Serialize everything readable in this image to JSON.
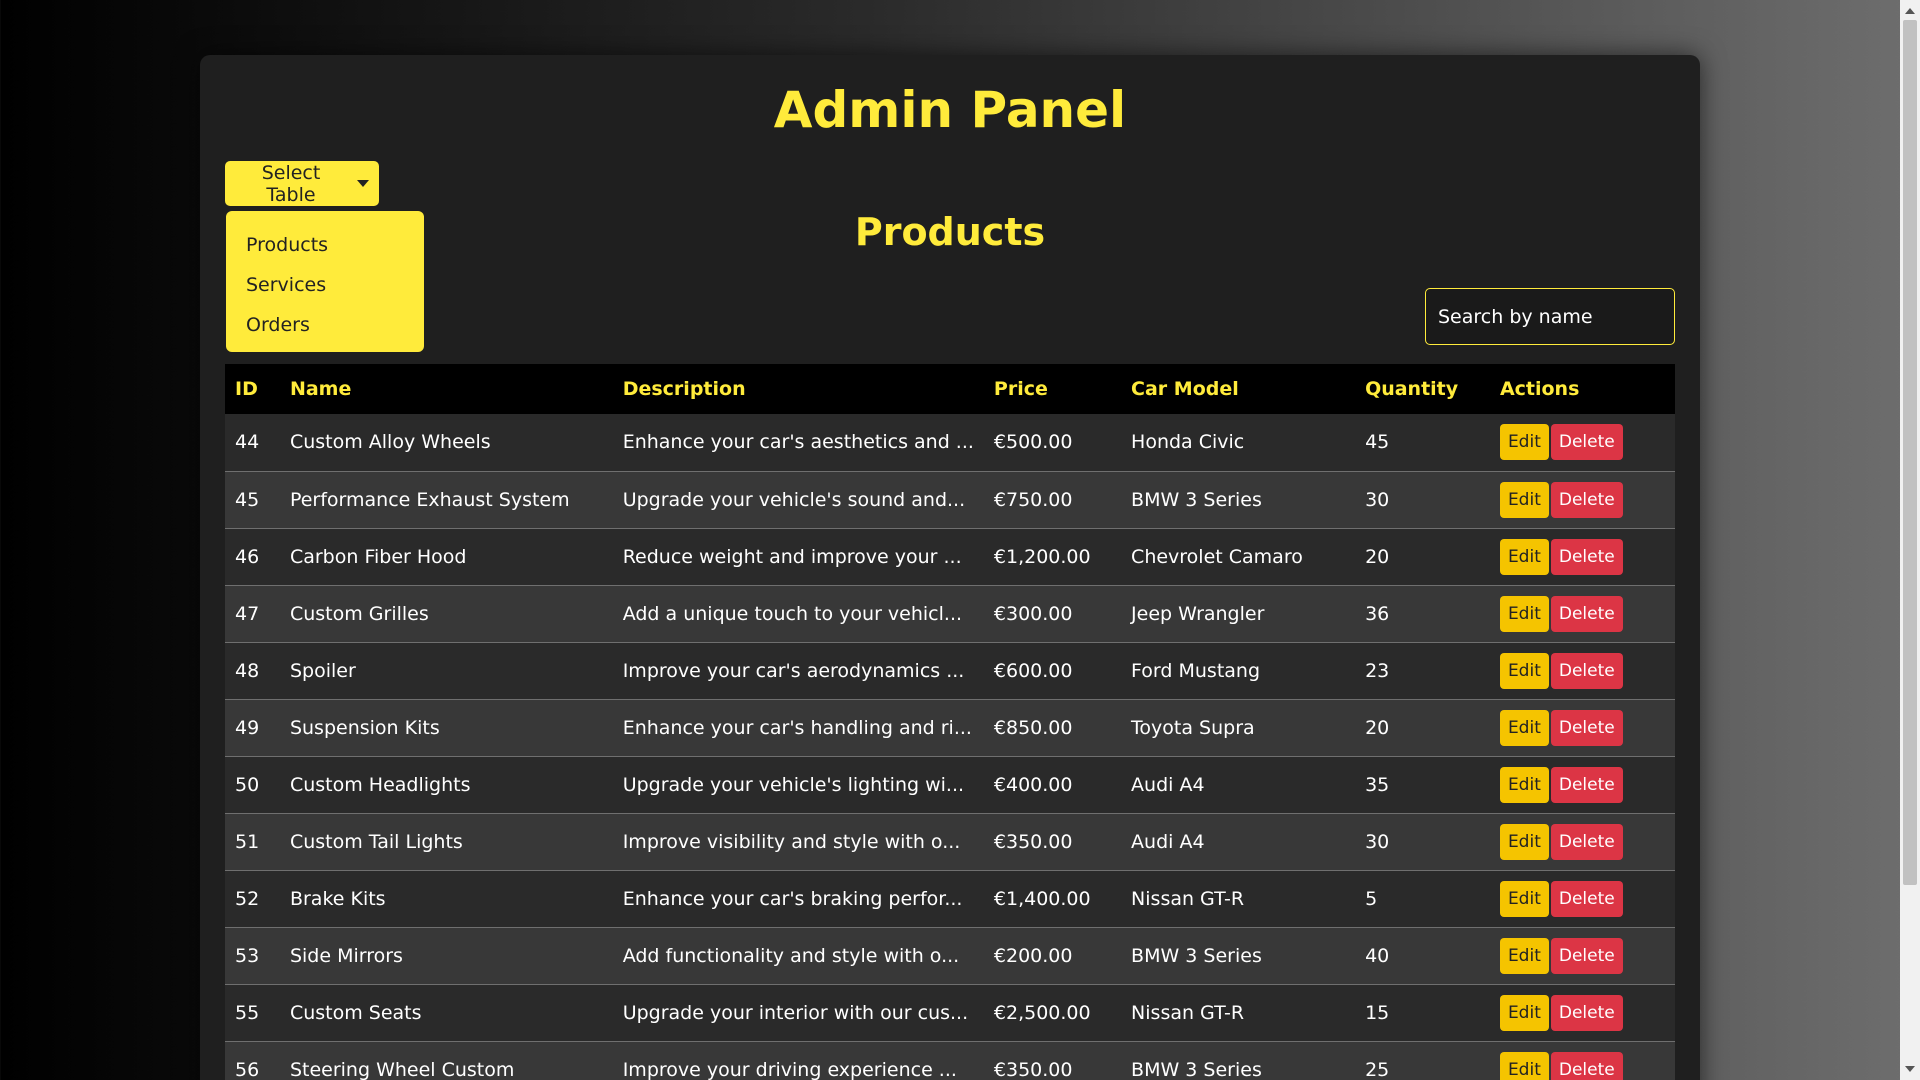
{
  "header": {
    "title": "Admin Panel"
  },
  "table_select": {
    "button_label": "Select Table",
    "options": [
      "Products",
      "Services",
      "Orders"
    ]
  },
  "section": {
    "title": "Products"
  },
  "search": {
    "placeholder": "Search by name"
  },
  "columns": [
    "ID",
    "Name",
    "Description",
    "Price",
    "Car Model",
    "Quantity",
    "Actions"
  ],
  "actions": {
    "edit_label": "Edit",
    "delete_label": "Delete"
  },
  "rows": [
    {
      "id": "44",
      "name": "Custom Alloy Wheels",
      "description": "Enhance your car's aesthetics and ...",
      "price": "€500.00",
      "car_model": "Honda Civic",
      "quantity": "45"
    },
    {
      "id": "45",
      "name": "Performance Exhaust System",
      "description": "Upgrade your vehicle's sound and...",
      "price": "€750.00",
      "car_model": "BMW 3 Series",
      "quantity": "30"
    },
    {
      "id": "46",
      "name": "Carbon Fiber Hood",
      "description": "Reduce weight and improve your ...",
      "price": "€1,200.00",
      "car_model": "Chevrolet Camaro",
      "quantity": "20"
    },
    {
      "id": "47",
      "name": "Custom Grilles",
      "description": "Add a unique touch to your vehicl...",
      "price": "€300.00",
      "car_model": "Jeep Wrangler",
      "quantity": "36"
    },
    {
      "id": "48",
      "name": "Spoiler",
      "description": "Improve your car's aerodynamics ...",
      "price": "€600.00",
      "car_model": "Ford Mustang",
      "quantity": "23"
    },
    {
      "id": "49",
      "name": "Suspension Kits",
      "description": "Enhance your car's handling and ri...",
      "price": "€850.00",
      "car_model": "Toyota Supra",
      "quantity": "20"
    },
    {
      "id": "50",
      "name": "Custom Headlights",
      "description": "Upgrade your vehicle's lighting wi...",
      "price": "€400.00",
      "car_model": "Audi A4",
      "quantity": "35"
    },
    {
      "id": "51",
      "name": "Custom Tail Lights",
      "description": "Improve visibility and style with o...",
      "price": "€350.00",
      "car_model": "Audi A4",
      "quantity": "30"
    },
    {
      "id": "52",
      "name": "Brake Kits",
      "description": "Enhance your car's braking perfor...",
      "price": "€1,400.00",
      "car_model": "Nissan GT-R",
      "quantity": "5"
    },
    {
      "id": "53",
      "name": "Side Mirrors",
      "description": "Add functionality and style with o...",
      "price": "€200.00",
      "car_model": "BMW 3 Series",
      "quantity": "40"
    },
    {
      "id": "55",
      "name": "Custom Seats",
      "description": "Upgrade your interior with our cus...",
      "price": "€2,500.00",
      "car_model": "Nissan GT-R",
      "quantity": "15"
    },
    {
      "id": "56",
      "name": "Steering Wheel Custom",
      "description": "Improve your driving experience ...",
      "price": "€350.00",
      "car_model": "BMW 3 Series",
      "quantity": "25"
    }
  ],
  "colors": {
    "accent": "#ffeb3b",
    "edit_button": "#f5c400",
    "delete_button": "#dc3545",
    "panel_bg": "#1f1f1f"
  }
}
